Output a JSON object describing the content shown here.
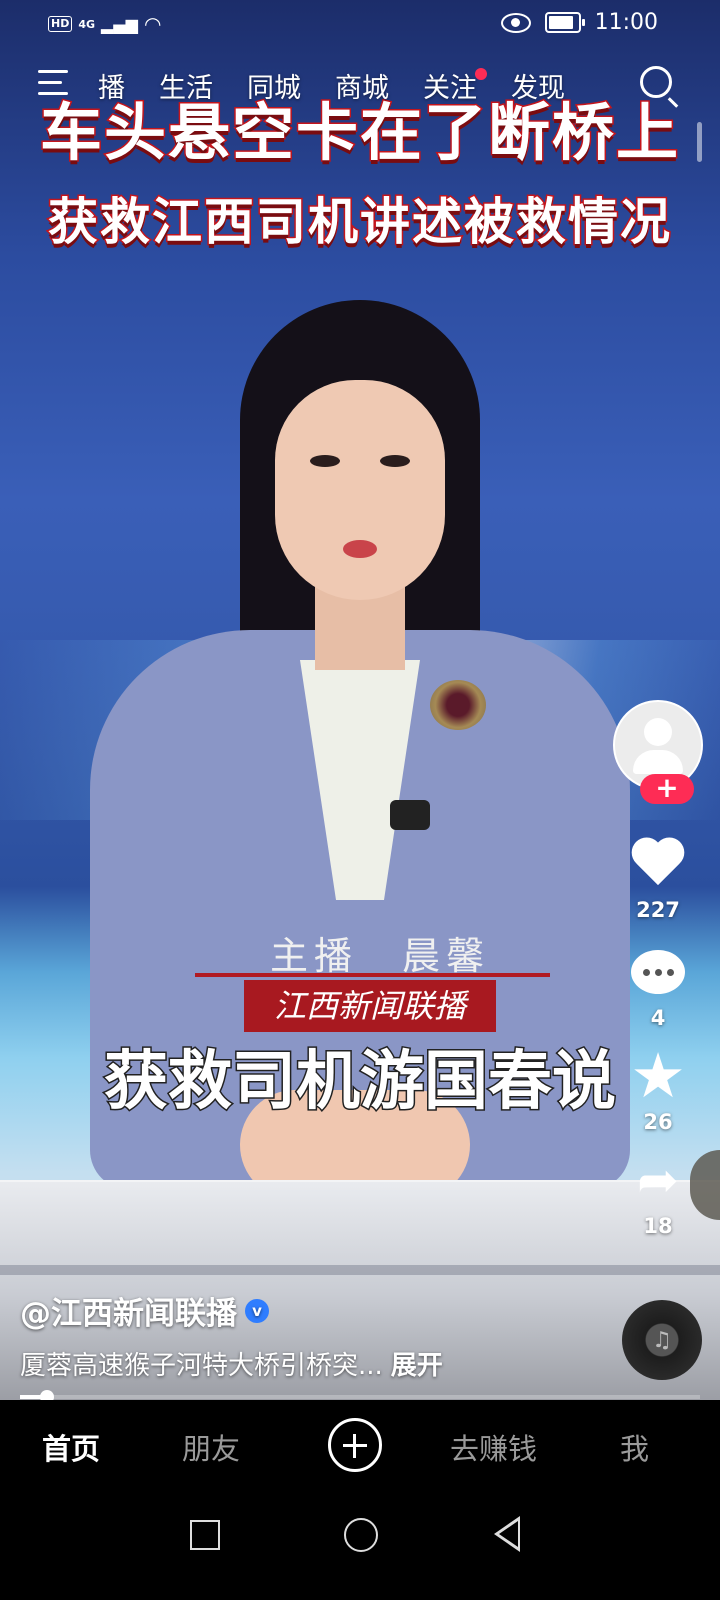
{
  "status_bar": {
    "hd": "HD",
    "network": "4G",
    "time": "11:00"
  },
  "top_nav": {
    "items": [
      "播",
      "生活",
      "同城",
      "商城",
      "关注",
      "发现"
    ],
    "has_notification_dot": "关注"
  },
  "video": {
    "headline_line1": "车头悬空卡在了断桥上",
    "headline_line2": "获救江西司机讲述被救情况",
    "anchor_label": "主播　晨馨",
    "program_logo": "江西新闻联播",
    "quote_caption": "获救司机游国春说"
  },
  "actions": {
    "likes": "227",
    "comments": "4",
    "favorites": "26",
    "shares": "18",
    "follow_label": "+"
  },
  "post": {
    "author": "@江西新闻联播",
    "verified_mark": "v",
    "description": "厦蓉高速猴子河特大桥引桥突...",
    "expand_label": "展开",
    "progress": 0.04
  },
  "tab_bar": {
    "home": "首页",
    "friends": "朋友",
    "earn": "去赚钱",
    "me": "我"
  },
  "colors": {
    "accent_red": "#fe2c55",
    "verified_blue": "#2f7dff",
    "headline_stroke": "#c4151c"
  }
}
